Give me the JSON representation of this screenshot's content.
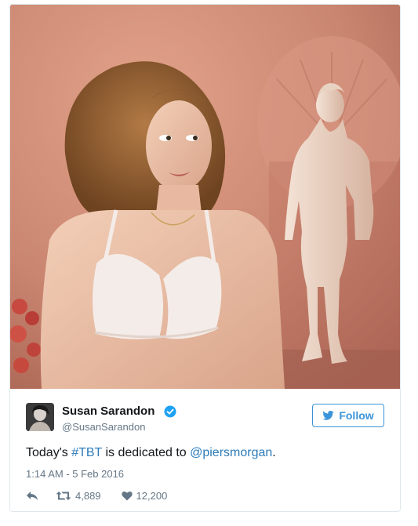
{
  "tweet": {
    "author": {
      "display_name": "Susan Sarandon",
      "screen_name": "@SusanSarandon",
      "verified": true,
      "avatar_icon": "profile-photo"
    },
    "follow_label": "Follow",
    "text": {
      "before": "Today's ",
      "hashtag": "#TBT",
      "middle": " is dedicated to ",
      "mention": "@piersmorgan",
      "after": "."
    },
    "timestamp": "1:14 AM - 5 Feb 2016",
    "stats": {
      "retweets": "4,889",
      "likes": "12,200"
    },
    "colors": {
      "link": "#2b7bb9",
      "follow_border": "#3b94d9",
      "verified": "#1da1f2",
      "muted": "#657786",
      "photo_wall": "#c98874"
    }
  }
}
